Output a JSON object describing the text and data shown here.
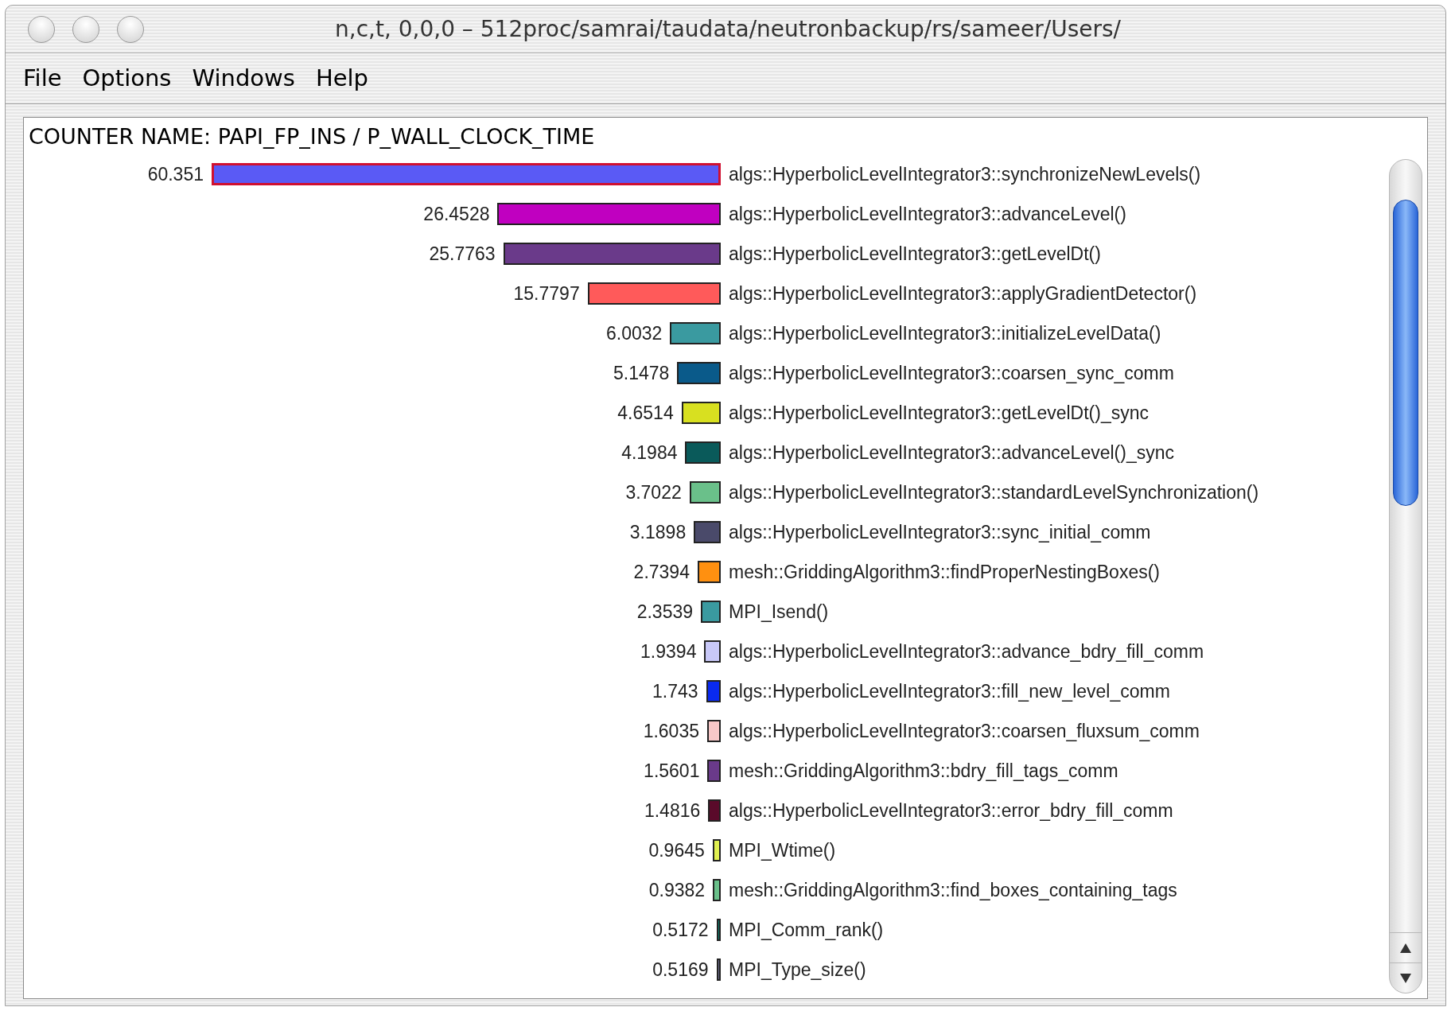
{
  "window": {
    "title": "n,c,t, 0,0,0 – 512proc/samrai/taudata/neutronbackup/rs/sameer/Users/"
  },
  "menu": [
    "File",
    "Options",
    "Windows",
    "Help"
  ],
  "header": "COUNTER NAME: PAPI_FP_INS / P_WALL_CLOCK_TIME",
  "rows": [
    {
      "value": "60.351",
      "name": "algs::HyperbolicLevelIntegrator3::synchronizeNewLevels()",
      "color": "#5a5af5",
      "selected": true
    },
    {
      "value": "26.4528",
      "name": "algs::HyperbolicLevelIntegrator3::advanceLevel()",
      "color": "#c000c0",
      "selected": false
    },
    {
      "value": "25.7763",
      "name": "algs::HyperbolicLevelIntegrator3::getLevelDt()",
      "color": "#6a3a8a",
      "selected": false
    },
    {
      "value": "15.7797",
      "name": "algs::HyperbolicLevelIntegrator3::applyGradientDetector()",
      "color": "#ff5a5a",
      "selected": false
    },
    {
      "value": "6.0032",
      "name": "algs::HyperbolicLevelIntegrator3::initializeLevelData()",
      "color": "#3a9aa0",
      "selected": false
    },
    {
      "value": "5.1478",
      "name": "algs::HyperbolicLevelIntegrator3::coarsen_sync_comm",
      "color": "#0a5a8a",
      "selected": false
    },
    {
      "value": "4.6514",
      "name": "algs::HyperbolicLevelIntegrator3::getLevelDt()_sync",
      "color": "#d8e020",
      "selected": false
    },
    {
      "value": "4.1984",
      "name": "algs::HyperbolicLevelIntegrator3::advanceLevel()_sync",
      "color": "#0a5a5a",
      "selected": false
    },
    {
      "value": "3.7022",
      "name": "algs::HyperbolicLevelIntegrator3::standardLevelSynchronization()",
      "color": "#6ac08a",
      "selected": false
    },
    {
      "value": "3.1898",
      "name": "algs::HyperbolicLevelIntegrator3::sync_initial_comm",
      "color": "#4a4a6a",
      "selected": false
    },
    {
      "value": "2.7394",
      "name": "mesh::GriddingAlgorithm3::findProperNestingBoxes()",
      "color": "#ff9010",
      "selected": false
    },
    {
      "value": "2.3539",
      "name": "MPI_Isend()",
      "color": "#3a9aa0",
      "selected": false
    },
    {
      "value": "1.9394",
      "name": "algs::HyperbolicLevelIntegrator3::advance_bdry_fill_comm",
      "color": "#c8c8f8",
      "selected": false
    },
    {
      "value": "1.743",
      "name": "algs::HyperbolicLevelIntegrator3::fill_new_level_comm",
      "color": "#0a2af0",
      "selected": false
    },
    {
      "value": "1.6035",
      "name": "algs::HyperbolicLevelIntegrator3::coarsen_fluxsum_comm",
      "color": "#f8c8c8",
      "selected": false
    },
    {
      "value": "1.5601",
      "name": "mesh::GriddingAlgorithm3::bdry_fill_tags_comm",
      "color": "#6a3a8a",
      "selected": false
    },
    {
      "value": "1.4816",
      "name": "algs::HyperbolicLevelIntegrator3::error_bdry_fill_comm",
      "color": "#5a0a2a",
      "selected": false
    },
    {
      "value": "0.9645",
      "name": "MPI_Wtime()",
      "color": "#e0f050",
      "selected": false
    },
    {
      "value": "0.9382",
      "name": "mesh::GriddingAlgorithm3::find_boxes_containing_tags",
      "color": "#6ac08a",
      "selected": false
    },
    {
      "value": "0.5172",
      "name": "MPI_Comm_rank()",
      "color": "#0a7a6a",
      "selected": false
    },
    {
      "value": "0.5169",
      "name": "MPI_Type_size()",
      "color": "#6a6a8a",
      "selected": false
    }
  ]
}
